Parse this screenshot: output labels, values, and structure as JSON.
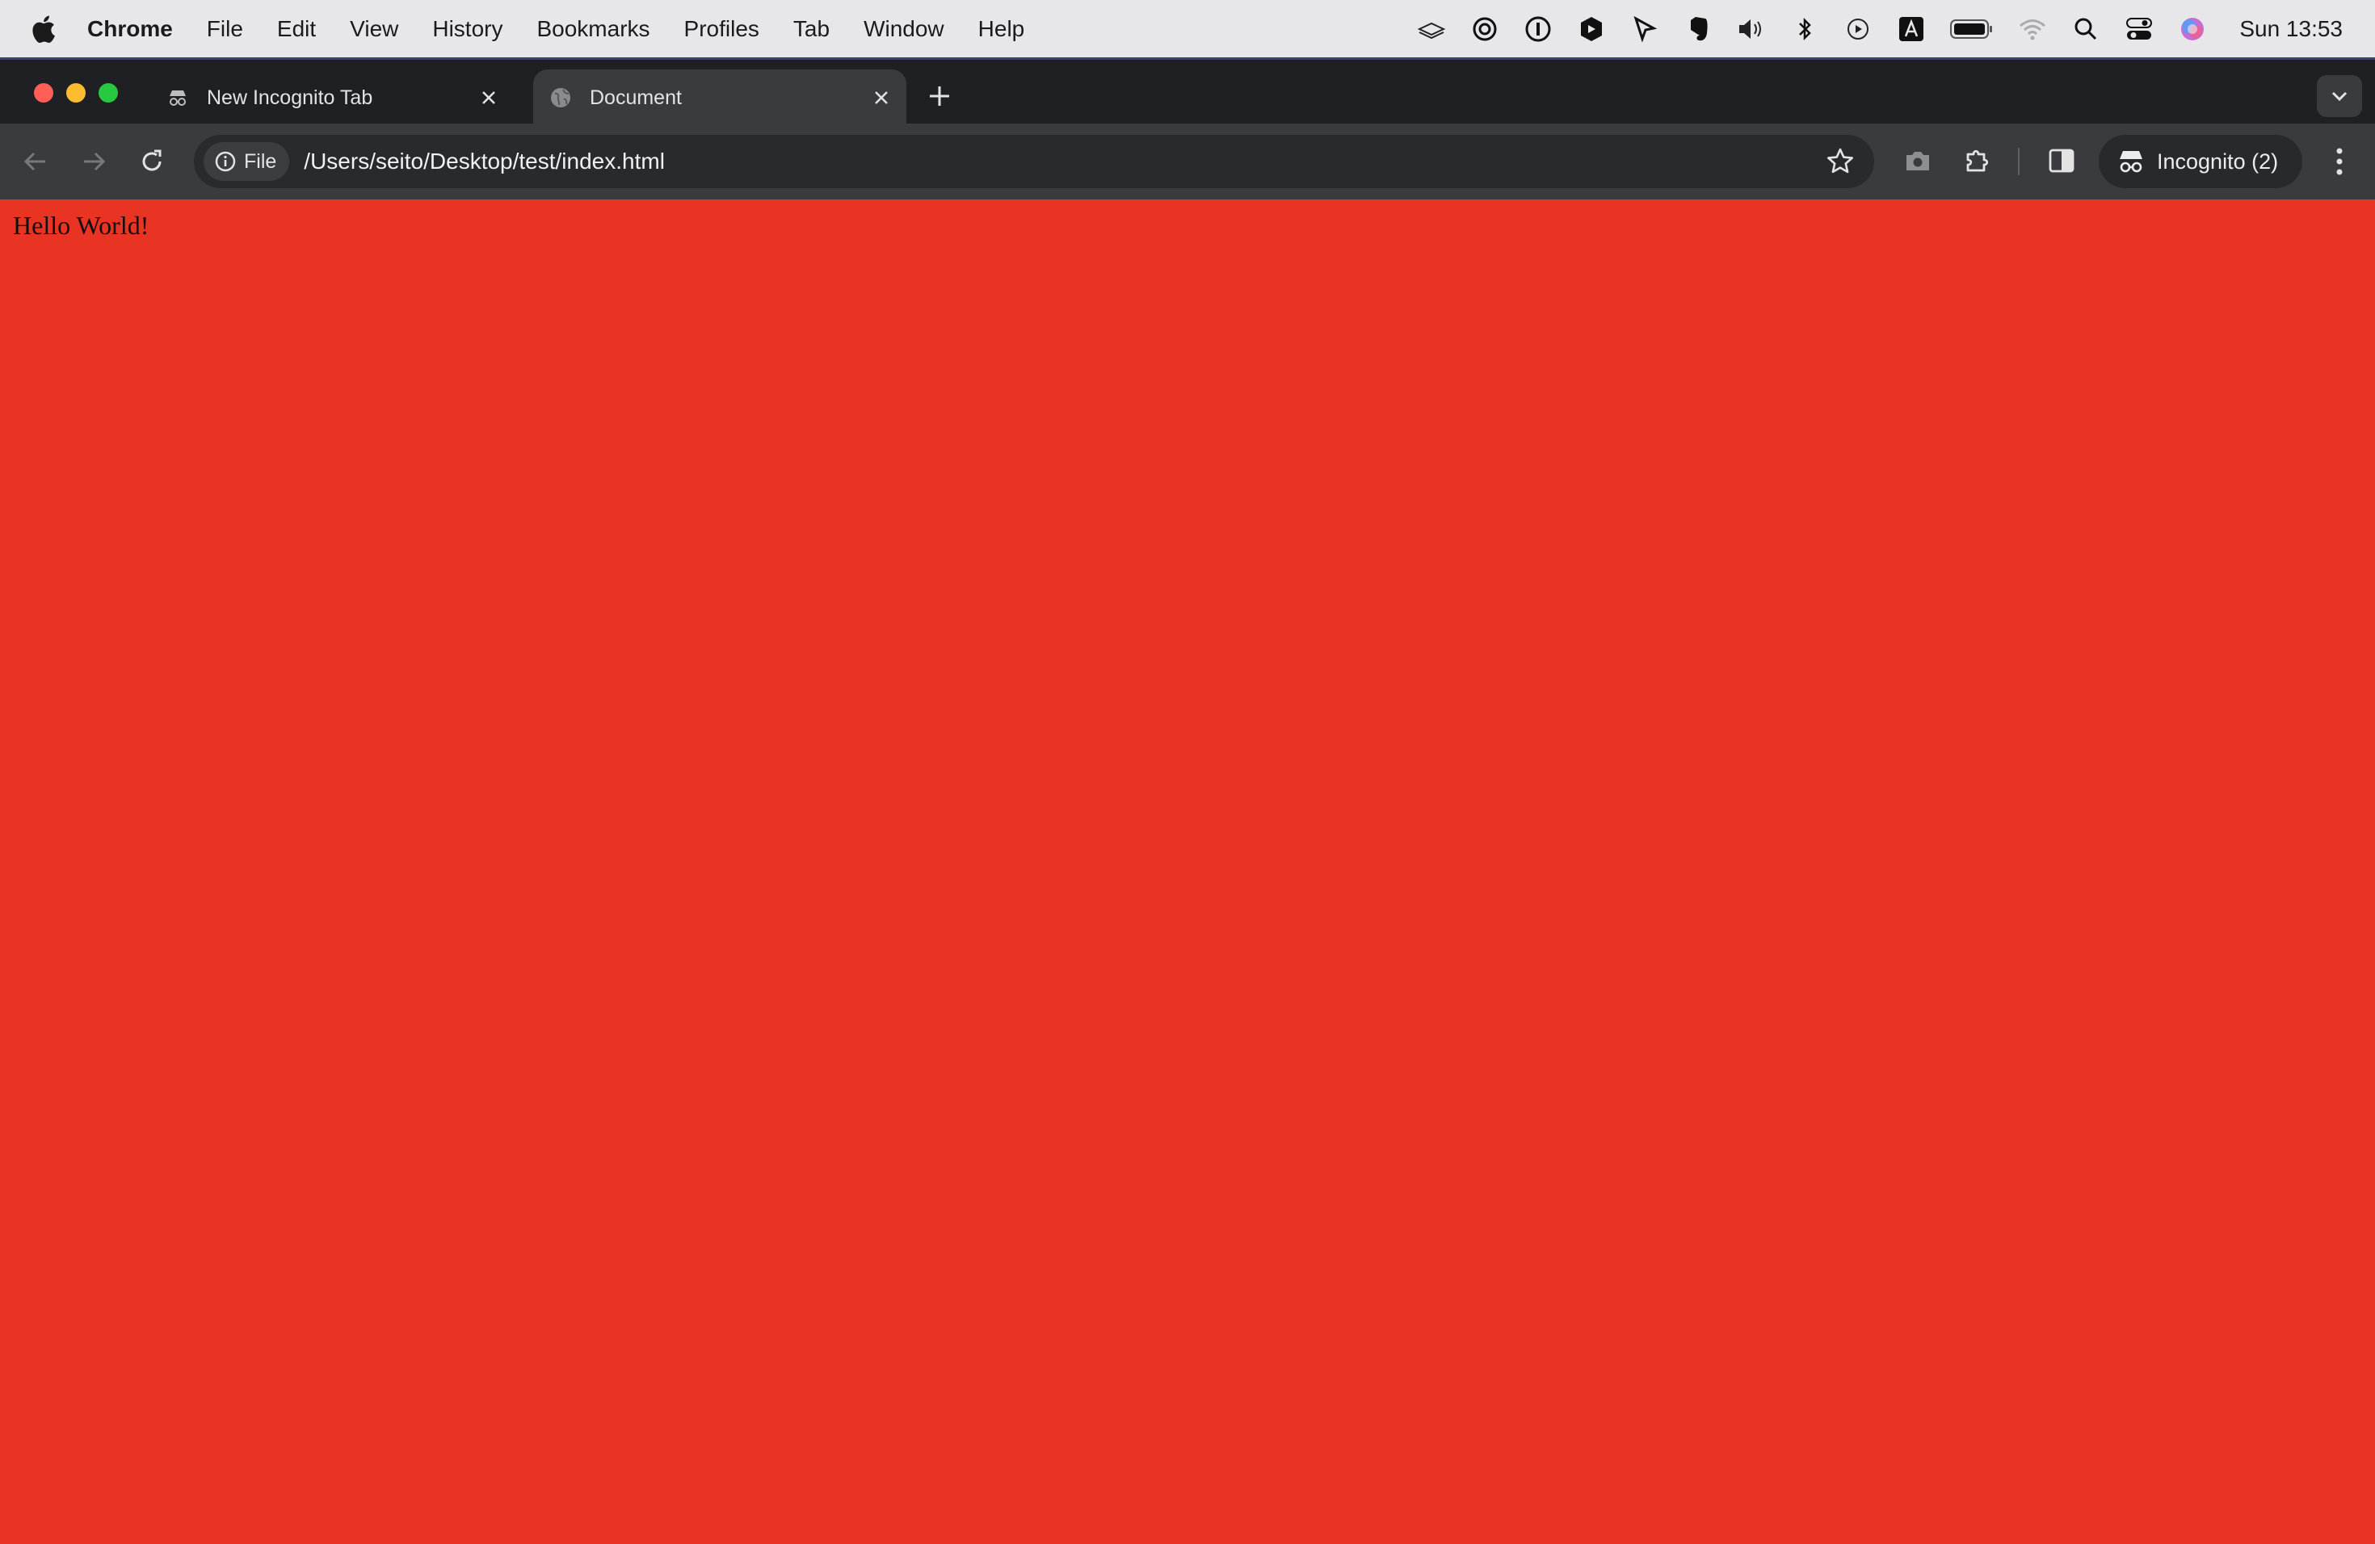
{
  "menubar": {
    "app_name": "Chrome",
    "items": [
      "File",
      "Edit",
      "View",
      "History",
      "Bookmarks",
      "Profiles",
      "Tab",
      "Window",
      "Help"
    ],
    "clock": "Sun 13:53"
  },
  "tabs": [
    {
      "title": "New Incognito Tab",
      "icon": "incognito-icon",
      "active": false
    },
    {
      "title": "Document",
      "icon": "globe-icon",
      "active": true
    }
  ],
  "toolbar": {
    "site_chip": "File",
    "url": "/Users/seito/Desktop/test/index.html",
    "profile_label": "Incognito (2)"
  },
  "page": {
    "text": "Hello World!",
    "background_color": "#e93323"
  },
  "colors": {
    "close": "#ff5f57",
    "minimize": "#febc2e",
    "zoom": "#28c840"
  }
}
